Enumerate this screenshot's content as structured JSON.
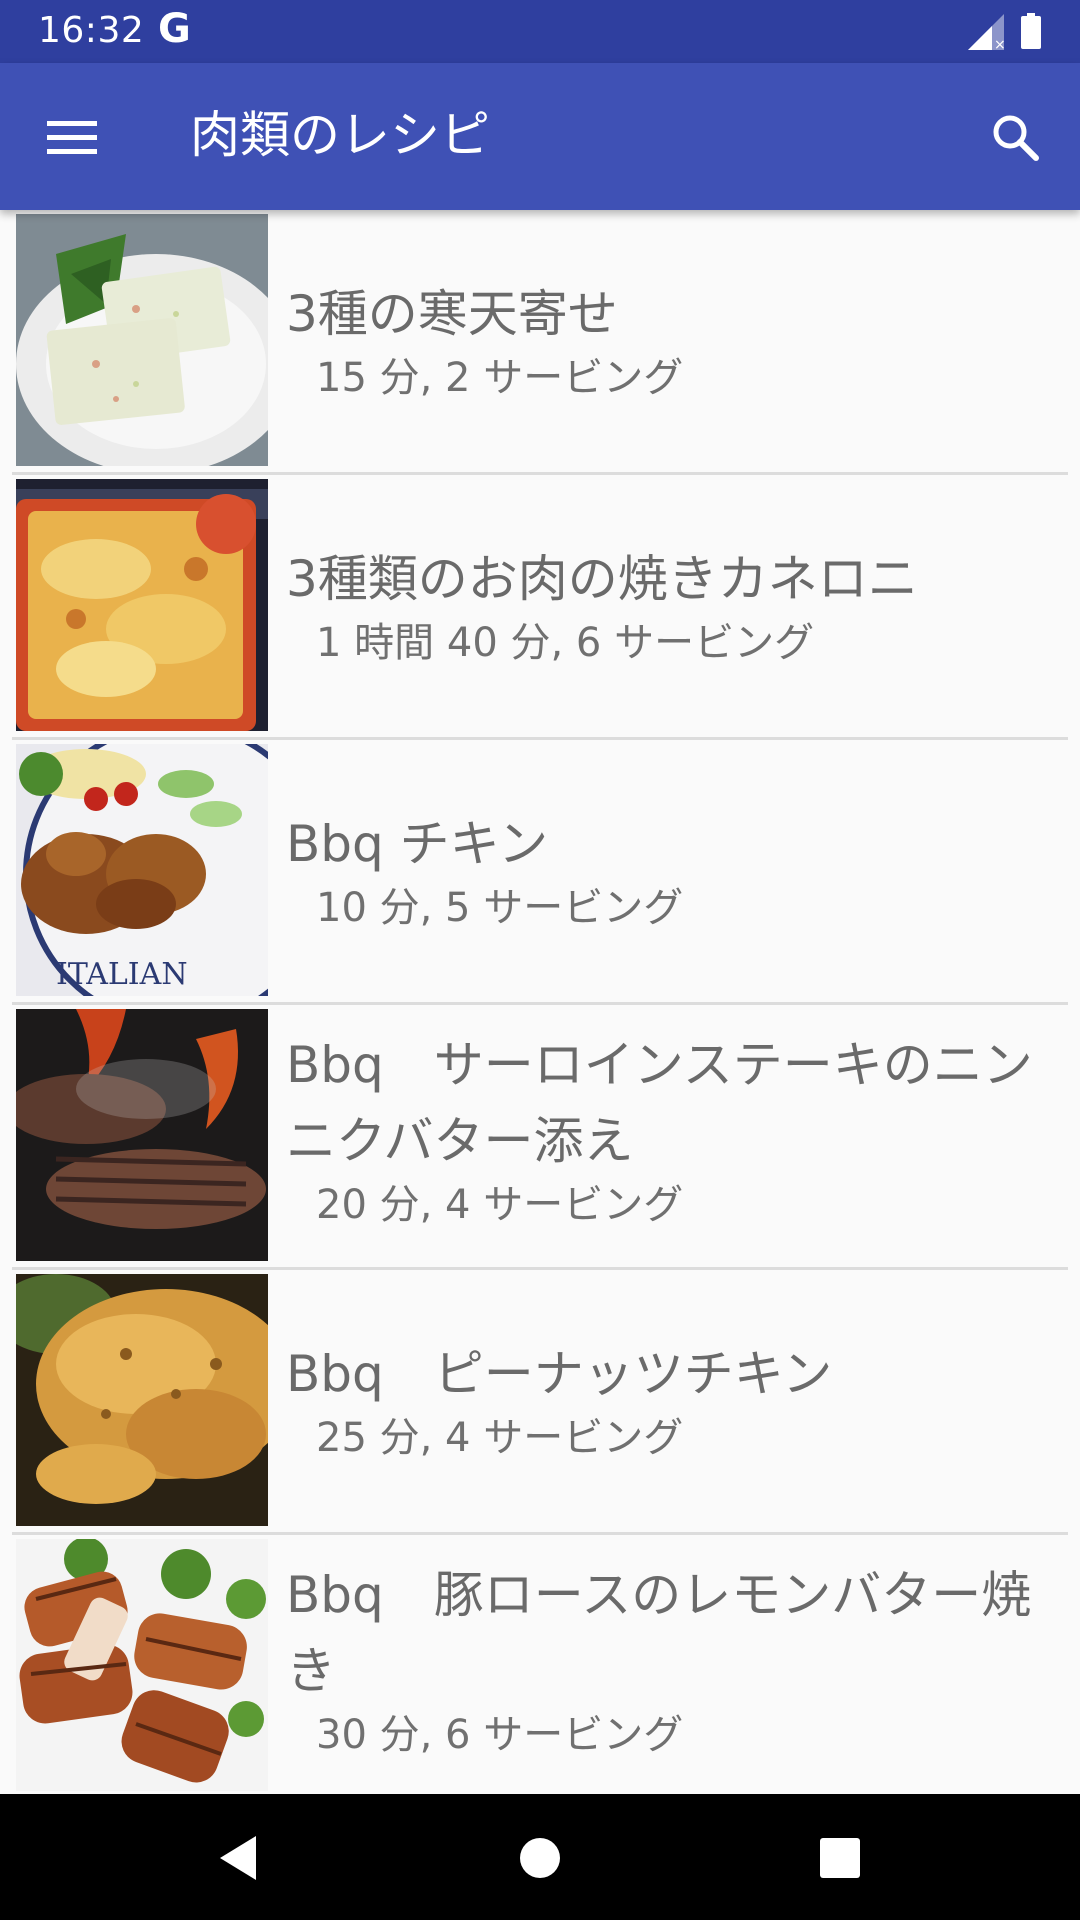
{
  "status_bar": {
    "time": "16:32",
    "g_label": "G",
    "icons": [
      "signal-icon",
      "battery-icon"
    ]
  },
  "app_bar": {
    "title": "肉類のレシピ",
    "menu_icon": "hamburger-menu-icon",
    "search_icon": "search-icon",
    "color": "#3f51b5",
    "status_color": "#2f3f9f"
  },
  "recipes": [
    {
      "name": "3種の寒天寄せ",
      "meta": "15 分, 2 サービング",
      "image": "agar-terrine-photo"
    },
    {
      "name": "3種類のお肉の焼きカネロニ",
      "meta": "1 時間 40 分, 6 サービング",
      "image": "baked-cannelloni-photo"
    },
    {
      "name": "Bbq チキン",
      "meta": "10 分, 5 サービング",
      "image": "bbq-chicken-photo"
    },
    {
      "name": "Bbq　サーロインステーキのニンニクバター添え",
      "meta": "20 分, 4 サービング",
      "image": "sirloin-steak-photo"
    },
    {
      "name": "Bbq　ピーナッツチキン",
      "meta": "25 分, 4 サービング",
      "image": "peanut-chicken-photo"
    },
    {
      "name": "Bbq　豚ロースのレモンバター焼き",
      "meta": "30 分, 6 サービング",
      "image": "pork-loin-photo"
    }
  ],
  "nav_bar": {
    "icons": [
      "back-icon",
      "home-icon",
      "recents-icon"
    ]
  }
}
